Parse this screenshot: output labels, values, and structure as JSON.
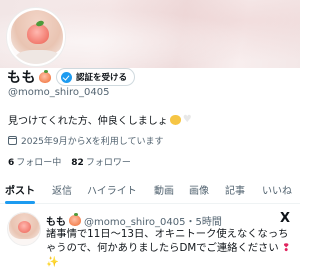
{
  "profile": {
    "display_name": "もも",
    "verify_label": "認証を受ける",
    "handle": "@momo_shiro_0405",
    "bio": "見つけてくれた方、仲良くしましょ",
    "joined": "2025年9月からXを利用しています",
    "following_count": "6",
    "following_label": "フォロー中",
    "followers_count": "82",
    "followers_label": "フォロワー"
  },
  "tabs": [
    {
      "label": "ポスト",
      "active": true
    },
    {
      "label": "返信"
    },
    {
      "label": "ハイライト"
    },
    {
      "label": "動画"
    },
    {
      "label": "画像"
    },
    {
      "label": "記事"
    },
    {
      "label": "いいね"
    }
  ],
  "post": {
    "name": "もも",
    "handle_time": "@momo_shiro_0405・5時間",
    "text": "諸事情で11日〜13日、オキニトーク使えなくなっちゃうので、何かありましたらDMでご連絡ください",
    "x_logo": "X"
  },
  "colors": {
    "accent": "#1d9bf0",
    "secondary_text": "#536471",
    "primary_text": "#0f1419"
  },
  "icons": [
    "peach-emoji",
    "verified-badge-icon",
    "calendar-icon",
    "cat-emoji",
    "white-heart-emoji",
    "x-logo-icon",
    "pin-emoji",
    "sparkle-emoji"
  ]
}
